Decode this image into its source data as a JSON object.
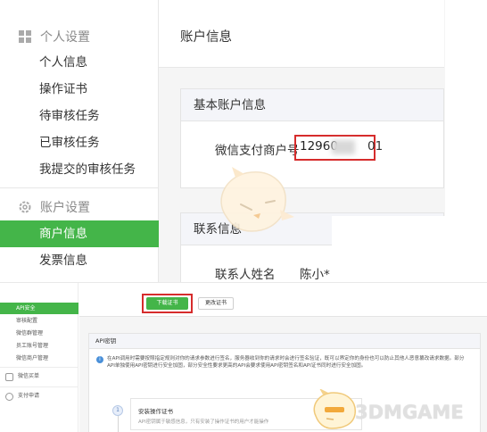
{
  "top": {
    "sidebar": {
      "personal_heading": "个人设置",
      "personal_items": [
        "个人信息",
        "操作证书",
        "待审核任务",
        "已审核任务",
        "我提交的审核任务"
      ],
      "account_heading": "账户设置",
      "account_items": [
        "商户信息",
        "发票信息"
      ],
      "active_item": "商户信息"
    },
    "page_title": "账户信息",
    "basic_card": {
      "title": "基本账户信息",
      "merchant_label": "微信支付商户号",
      "merchant_value": "12960"
    },
    "contact_card": {
      "title": "联系信息",
      "name_label": "联系人姓名",
      "name_value": "陈小*"
    }
  },
  "bottom": {
    "sidebar": {
      "items": [
        "API安全",
        "审核配置",
        "微信群管理",
        "员工账号管理",
        "微信商户管理"
      ],
      "active_item": "API安全",
      "group1": "微信买单",
      "group2": "支付申请"
    },
    "toolbar": {
      "download_cert": "下载证书",
      "change_cert": "更改证书"
    },
    "api_card": {
      "title": "API密钥",
      "notice": "在API调用时需要按照指定规则对你的请求参数进行签名，服务器收到你的请求时会进行签名验证，既可以界定你的身份也可以防止其他人恶意篡改请求数据。部分API单独使用API密钥进行安全加固，部分安全性要求更高的API会要求使用API密钥签名和API证书同时进行安全加固。",
      "step_number": "1",
      "step_title": "安装操作证书",
      "step_desc": "API密钥属于敏感信息，只有安装了操作证书的用户才能操作"
    }
  },
  "watermark": {
    "brand": "3DMGAME"
  },
  "colors": {
    "accent_green": "#44b549",
    "highlight_red": "#d62c2c",
    "page_bg": "#f5f5f5"
  }
}
